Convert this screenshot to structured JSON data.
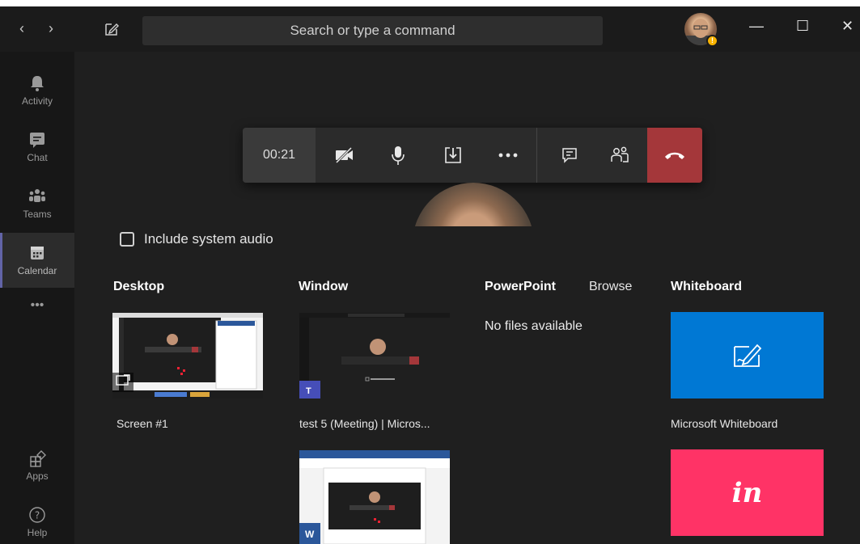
{
  "titlebar": {
    "back": "‹",
    "forward": "›",
    "search_placeholder": "Search or type a command",
    "status_glyph": "!",
    "minimize": "—",
    "maximize": "☐",
    "close": "✕"
  },
  "rail": {
    "items": [
      {
        "label": "Activity",
        "icon": "bell-icon"
      },
      {
        "label": "Chat",
        "icon": "chat-icon"
      },
      {
        "label": "Teams",
        "icon": "teams-icon"
      },
      {
        "label": "Calendar",
        "icon": "calendar-icon",
        "active": true
      },
      {
        "label": "•••",
        "icon": "more-icon"
      },
      {
        "label": "Apps",
        "icon": "apps-icon"
      },
      {
        "label": "Help",
        "icon": "help-icon"
      }
    ]
  },
  "toolbar": {
    "timer": "00:21",
    "buttons": [
      "camera-off-icon",
      "microphone-icon",
      "share-tray-icon",
      "more-options-icon",
      "conversation-icon",
      "participants-icon",
      "hang-up-icon"
    ]
  },
  "share": {
    "include_audio": "Include system audio",
    "columns": {
      "desktop": "Desktop",
      "window": "Window",
      "powerpoint": "PowerPoint",
      "browse": "Browse",
      "whiteboard": "Whiteboard"
    },
    "desktop_caption": "Screen #1",
    "window_caption": "test 5 (Meeting) | Micros...",
    "no_files": "No files available",
    "whiteboard_caption": "Microsoft Whiteboard",
    "invision_logo": "in"
  },
  "colors": {
    "accent": "#6264a7",
    "hangup": "#a4373a",
    "whiteboard": "#0078d4",
    "invision": "#ff3366"
  }
}
